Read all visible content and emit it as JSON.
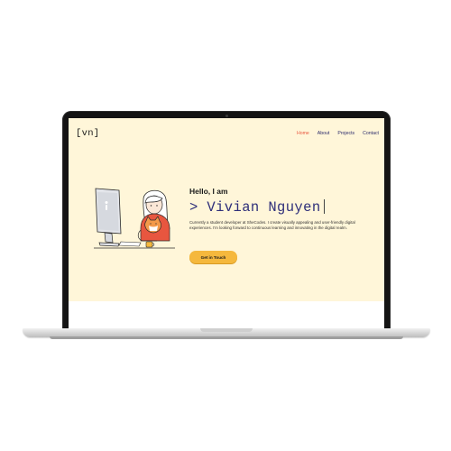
{
  "site": {
    "logo": "[vn]",
    "nav": [
      {
        "label": "Home",
        "active": true
      },
      {
        "label": "About",
        "active": false
      },
      {
        "label": "Projects",
        "active": false
      },
      {
        "label": "Contact",
        "active": false
      }
    ]
  },
  "hero": {
    "greeting": "Hello, I am",
    "name": "> Vivian Nguyen",
    "description": "Currently a student developer at SheCodes. I create visually appealing and user-friendly digital experiences. I'm looking forward to continuous learning and innovating in the digital realm.",
    "cta_label": "Get in Touch"
  },
  "colors": {
    "page_background": "#fff6d9",
    "active_nav": "#e8563f",
    "name_text": "#2f2f7a",
    "cta_button": "#f5b83d"
  },
  "icons": {
    "illustration": "person-at-computer-with-cat"
  }
}
